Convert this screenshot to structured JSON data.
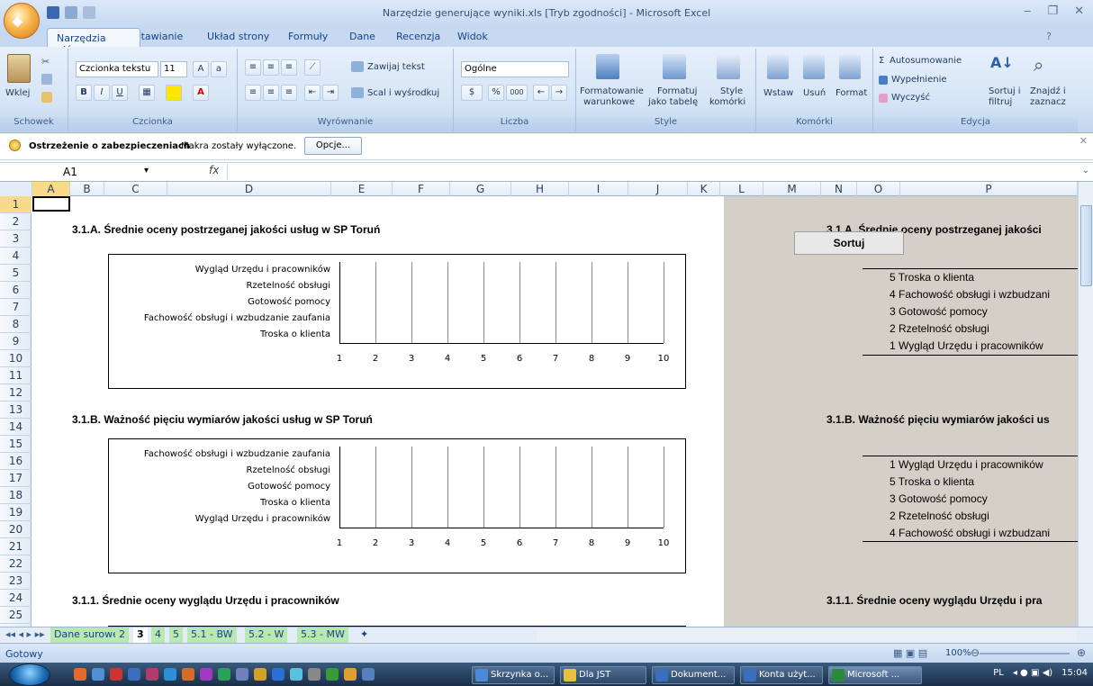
{
  "window": {
    "title": "Narzędzie generujące wyniki.xls [Tryb zgodności] - Microsoft Excel",
    "office_button": "Office"
  },
  "ribbon": {
    "tabs": [
      "Narzędzia główne",
      "Wstawianie",
      "Układ strony",
      "Formuły",
      "Dane",
      "Recenzja",
      "Widok"
    ],
    "groups": {
      "schowek": {
        "label": "Schowek",
        "paste": "Wklej"
      },
      "czcionka": {
        "label": "Czcionka",
        "font": "Czcionka tekstu",
        "size": "11"
      },
      "wyrownanie": {
        "label": "Wyrównanie",
        "wrap": "Zawijaj tekst",
        "merge": "Scal i wyśrodkuj"
      },
      "liczba": {
        "label": "Liczba",
        "format": "Ogólne"
      },
      "style": {
        "label": "Style",
        "cond": "Formatowanie",
        "cond2": "warunkowe",
        "table": "Formatuj",
        "table2": "jako tabelę",
        "cell": "Style",
        "cell2": "komórki"
      },
      "komorki": {
        "label": "Komórki",
        "insert": "Wstaw",
        "delete": "Usuń",
        "format": "Format"
      },
      "edycja": {
        "label": "Edycja",
        "autosum": "Autosumowanie",
        "fill": "Wypełnienie",
        "clear": "Wyczyść",
        "sort": "Sortuj i",
        "sort2": "filtruj",
        "find": "Znajdź i",
        "find2": "zaznacz"
      }
    }
  },
  "security_bar": {
    "title": "Ostrzeżenie o zabezpieczeniach",
    "message": "Makra zostały wyłączone.",
    "button": "Opcje..."
  },
  "formula_bar": {
    "cell_ref": "A1",
    "fx": "fx",
    "value": ""
  },
  "columns": [
    "A",
    "B",
    "C",
    "D",
    "E",
    "F",
    "G",
    "H",
    "I",
    "J",
    "K",
    "L",
    "M",
    "N",
    "O",
    "P"
  ],
  "rows": [
    "1",
    "2",
    "3",
    "4",
    "5",
    "6",
    "7",
    "8",
    "9",
    "10",
    "11",
    "12",
    "13",
    "14",
    "15",
    "16",
    "17",
    "18",
    "19",
    "20",
    "21",
    "22",
    "23",
    "24",
    "25"
  ],
  "sheet": {
    "heading_a": "3.1.A. Średnie oceny postrzeganej jakości usług w SP Toruń",
    "heading_b": "3.1.B. Ważność pięciu wymiarów jakości usług w SP Toruń",
    "heading_c": "3.1.1. Średnie oceny wyglądu Urzędu i pracowników",
    "right_heading_a": "3.1.A. Średnie oceny postrzeganej jakości",
    "right_heading_b": "3.1.B. Ważność pięciu wymiarów jakości us",
    "right_heading_c": "3.1.1. Średnie oceny wyglądu Urzędu i pra",
    "sort_button": "Sortuj",
    "list_a": [
      "5 Troska o klienta",
      "4 Fachowość obsługi i wzbudzani",
      "3 Gotowość pomocy",
      "2 Rzetelność obsługi",
      "1 Wygląd Urzędu i pracowników"
    ],
    "list_b": [
      "1 Wygląd Urzędu i pracowników",
      "5 Troska o klienta",
      "3 Gotowość pomocy",
      "2 Rzetelność obsługi",
      "4 Fachowość obsługi i wzbudzani"
    ]
  },
  "chart_data": [
    {
      "type": "bar",
      "categories": [
        "Wygląd Urzędu i pracowników",
        "Rzetelność obsługi",
        "Gotowość pomocy",
        "Fachowość obsługi i wzbudzanie zaufania",
        "Troska o klienta"
      ],
      "values": [],
      "x_ticks": [
        "1",
        "2",
        "3",
        "4",
        "5",
        "6",
        "7",
        "8",
        "9",
        "10"
      ],
      "xlim": [
        1,
        10
      ],
      "grid": true
    },
    {
      "type": "bar",
      "categories": [
        "Fachowość obsługi i wzbudzanie zaufania",
        "Rzetelność obsługi",
        "Gotowość pomocy",
        "Troska o klienta",
        "Wygląd Urzędu i pracowników"
      ],
      "values": [],
      "x_ticks": [
        "1",
        "2",
        "3",
        "4",
        "5",
        "6",
        "7",
        "8",
        "9",
        "10"
      ],
      "xlim": [
        1,
        10
      ],
      "grid": true
    }
  ],
  "sheet_tabs": [
    "Dane surowe",
    "2",
    "3",
    "4",
    "5",
    "5.1 - BW",
    "5.2 - W",
    "5.3 - MW"
  ],
  "active_sheet": "3",
  "status": {
    "text": "Gotowy",
    "zoom": "100%"
  },
  "taskbar": {
    "buttons": [
      "Skrzynka o...",
      "Dla JST",
      "Dokument...",
      "Konta użyt...",
      "Microsoft ..."
    ],
    "lang": "PL",
    "time": "15:04"
  }
}
